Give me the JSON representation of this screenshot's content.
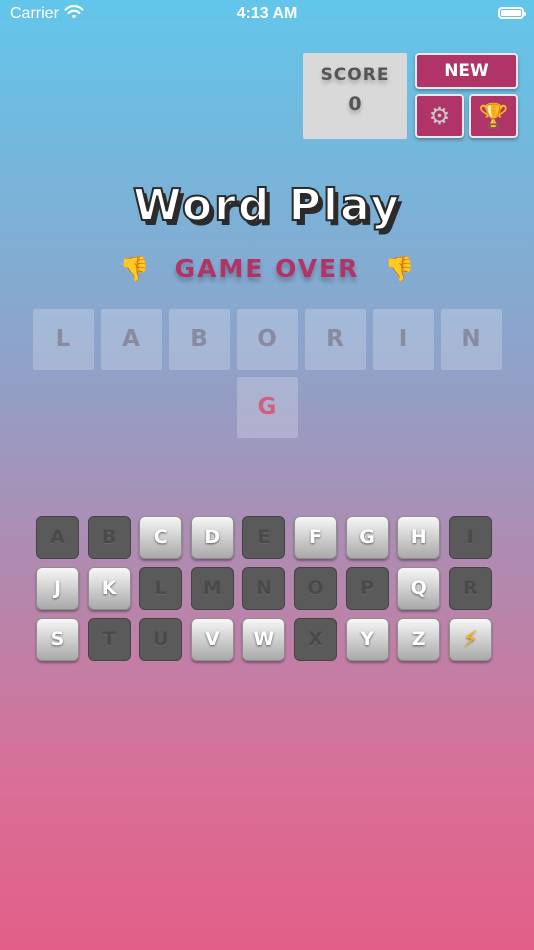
{
  "status_bar": {
    "carrier": "Carrier",
    "time": "4:13 AM"
  },
  "score": {
    "label": "SCORE",
    "value": "0"
  },
  "buttons": {
    "new_label": "NEW",
    "settings_icon": "⚙",
    "trophy_icon": "🏆"
  },
  "title": "Word Play",
  "game_status": {
    "text": "GAME OVER",
    "icon": "👎"
  },
  "word": {
    "tiles": [
      {
        "letter": "L",
        "found": false
      },
      {
        "letter": "A",
        "found": false
      },
      {
        "letter": "B",
        "found": false
      },
      {
        "letter": "O",
        "found": false
      },
      {
        "letter": "R",
        "found": false
      },
      {
        "letter": "I",
        "found": false
      },
      {
        "letter": "N",
        "found": false
      },
      {
        "letter": "G",
        "found": true
      }
    ]
  },
  "keyboard": {
    "keys": [
      {
        "label": "A",
        "state": "used"
      },
      {
        "label": "B",
        "state": "used"
      },
      {
        "label": "C",
        "state": "available"
      },
      {
        "label": "D",
        "state": "available"
      },
      {
        "label": "E",
        "state": "used"
      },
      {
        "label": "F",
        "state": "available"
      },
      {
        "label": "G",
        "state": "available"
      },
      {
        "label": "H",
        "state": "available"
      },
      {
        "label": "I",
        "state": "used"
      },
      {
        "label": "J",
        "state": "available"
      },
      {
        "label": "K",
        "state": "available"
      },
      {
        "label": "L",
        "state": "used"
      },
      {
        "label": "M",
        "state": "used"
      },
      {
        "label": "N",
        "state": "used"
      },
      {
        "label": "O",
        "state": "used"
      },
      {
        "label": "P",
        "state": "used"
      },
      {
        "label": "Q",
        "state": "available"
      },
      {
        "label": "R",
        "state": "used"
      },
      {
        "label": "S",
        "state": "available"
      },
      {
        "label": "T",
        "state": "used"
      },
      {
        "label": "U",
        "state": "used"
      },
      {
        "label": "V",
        "state": "available"
      },
      {
        "label": "W",
        "state": "available"
      },
      {
        "label": "X",
        "state": "used"
      },
      {
        "label": "Y",
        "state": "available"
      },
      {
        "label": "Z",
        "state": "available"
      },
      {
        "label": "⚡",
        "state": "available",
        "icon": "lightning-icon"
      }
    ]
  }
}
